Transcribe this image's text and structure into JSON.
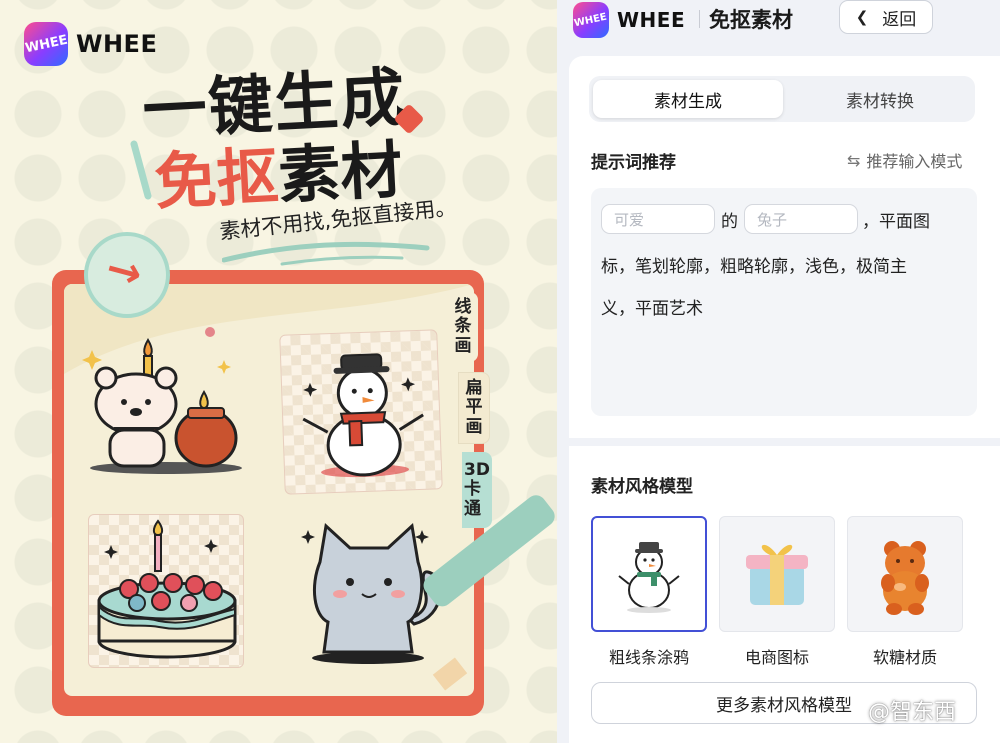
{
  "poster": {
    "brand": "WHEE",
    "logo_mark": "WHEE",
    "headline_line1": "一键生成",
    "headline_line2_red": "免抠",
    "headline_line2_dark": "素材",
    "slogan": "素材不用找,免抠直接用。",
    "style_tabs": [
      "线条画",
      "扁平画",
      "3D卡通"
    ],
    "samples": [
      "bear-with-candle",
      "snowman",
      "strawberry-cake",
      "gray-cat"
    ]
  },
  "header": {
    "brand": "WHEE",
    "logo_mark": "WHEE",
    "title": "免抠素材",
    "back_label": "返回"
  },
  "tabs": [
    {
      "label": "素材生成",
      "active": true
    },
    {
      "label": "素材转换",
      "active": false
    }
  ],
  "prompt": {
    "section_title": "提示词推荐",
    "switch_label": "推荐输入模式",
    "field1_placeholder": "可爱",
    "connector": "的",
    "field2_placeholder": "兔子",
    "text_line1_tail": "，平面图",
    "text_line2": "标，笔划轮廓，粗略轮廓，浅色，极简主",
    "text_line3": "义，平面艺术"
  },
  "styles": {
    "section_title": "素材风格模型",
    "items": [
      {
        "label": "粗线条涂鸦",
        "selected": true,
        "icon": "snowman-icon"
      },
      {
        "label": "电商图标",
        "selected": false,
        "icon": "gift-box-icon"
      },
      {
        "label": "软糖材质",
        "selected": false,
        "icon": "gummy-bear-icon"
      }
    ],
    "more_label": "更多素材风格模型"
  },
  "watermark": "@智东西",
  "colors": {
    "accent": "#4350d6",
    "poster_red": "#e85a48",
    "poster_mint": "#9ccfbe",
    "poster_bg": "#f8f5e3"
  }
}
